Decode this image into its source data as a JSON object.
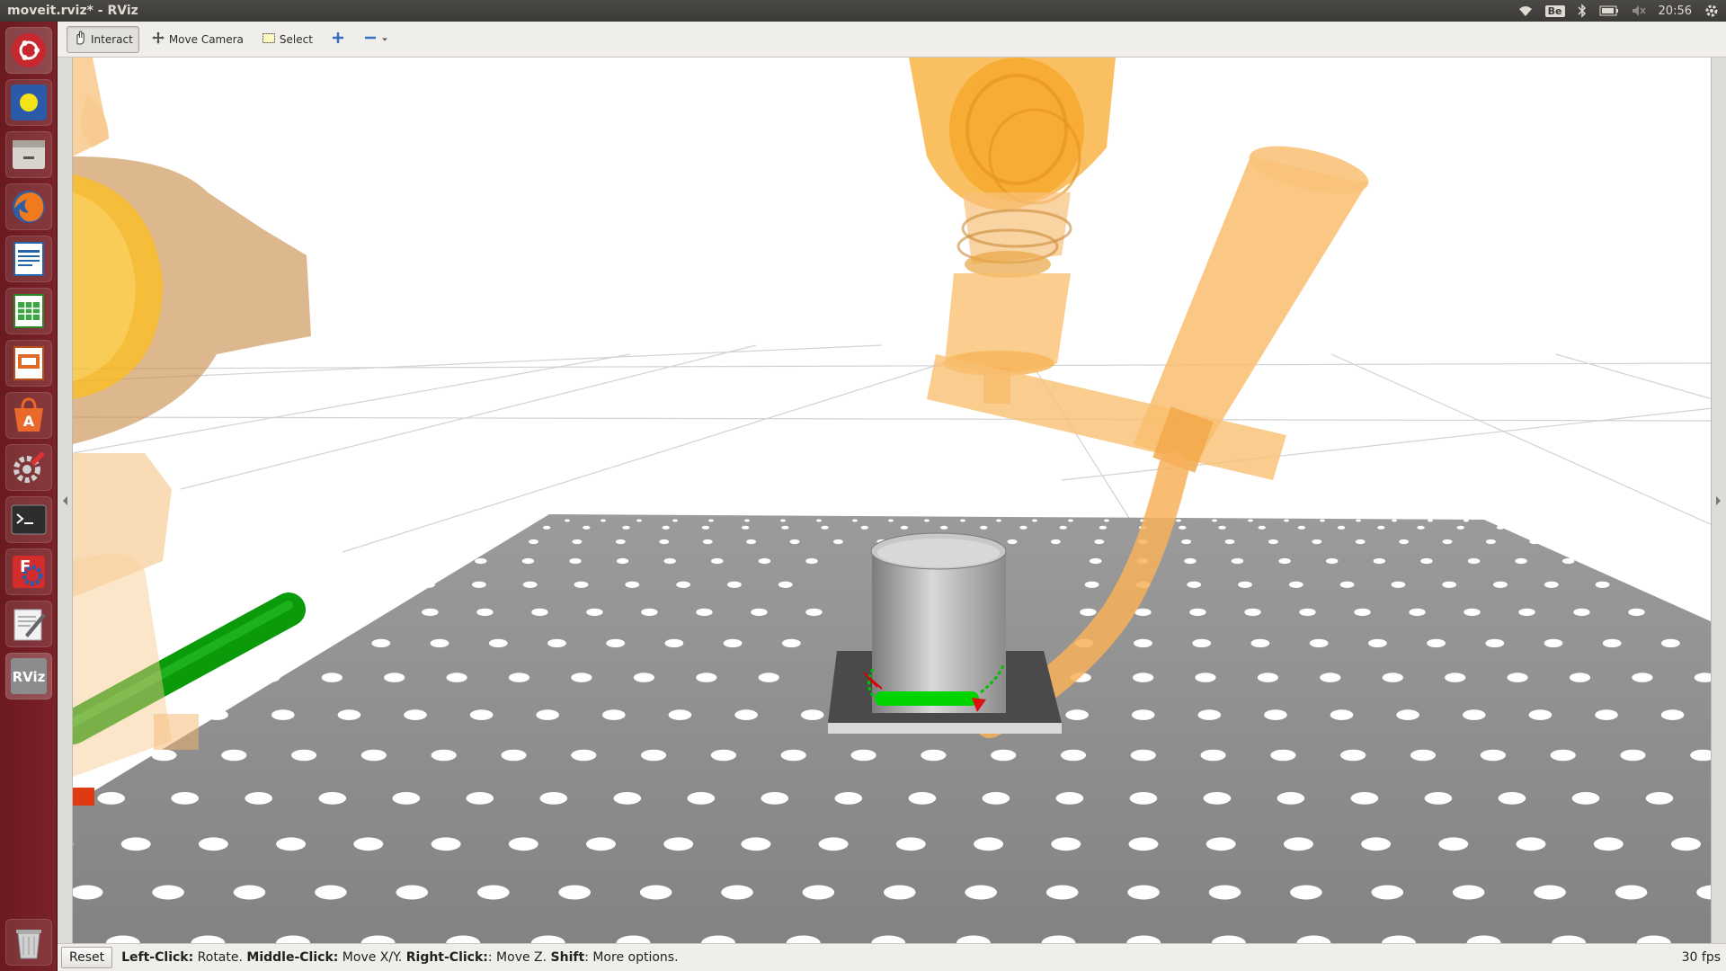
{
  "window": {
    "title": "moveit.rviz* - RViz"
  },
  "topbar": {
    "keyboard_layout": "Be",
    "clock": "20:56"
  },
  "launcher": {
    "items": [
      {
        "name": "ubuntu-dash-icon"
      },
      {
        "name": "system-icon"
      },
      {
        "name": "files-icon"
      },
      {
        "name": "firefox-icon"
      },
      {
        "name": "writer-icon"
      },
      {
        "name": "calc-icon"
      },
      {
        "name": "impress-icon"
      },
      {
        "name": "software-center-icon"
      },
      {
        "name": "system-settings-icon"
      },
      {
        "name": "terminal-icon"
      },
      {
        "name": "configuration-icon"
      },
      {
        "name": "text-editor-icon"
      },
      {
        "name": "rviz-icon",
        "label": "RViz"
      },
      {
        "name": "trash-icon"
      }
    ]
  },
  "toolbar": {
    "interact": "Interact",
    "move_camera": "Move Camera",
    "select": "Select"
  },
  "statusbar": {
    "reset": "Reset",
    "hint_left_click": "Left-Click:",
    "hint_left_click_action": " Rotate. ",
    "hint_middle_click": "Middle-Click:",
    "hint_middle_click_action": " Move X/Y. ",
    "hint_right_click": "Right-Click:",
    "hint_right_click_action": ": Move Z. ",
    "hint_shift": "Shift",
    "hint_shift_action": ": More options.",
    "fps": "30 fps"
  },
  "colors": {
    "launcher": "#7a2228",
    "robot": "#f9a43a",
    "table": "#8a8a8a",
    "gripper_green": "#00d400",
    "axis_green": "#0a9a0a"
  }
}
